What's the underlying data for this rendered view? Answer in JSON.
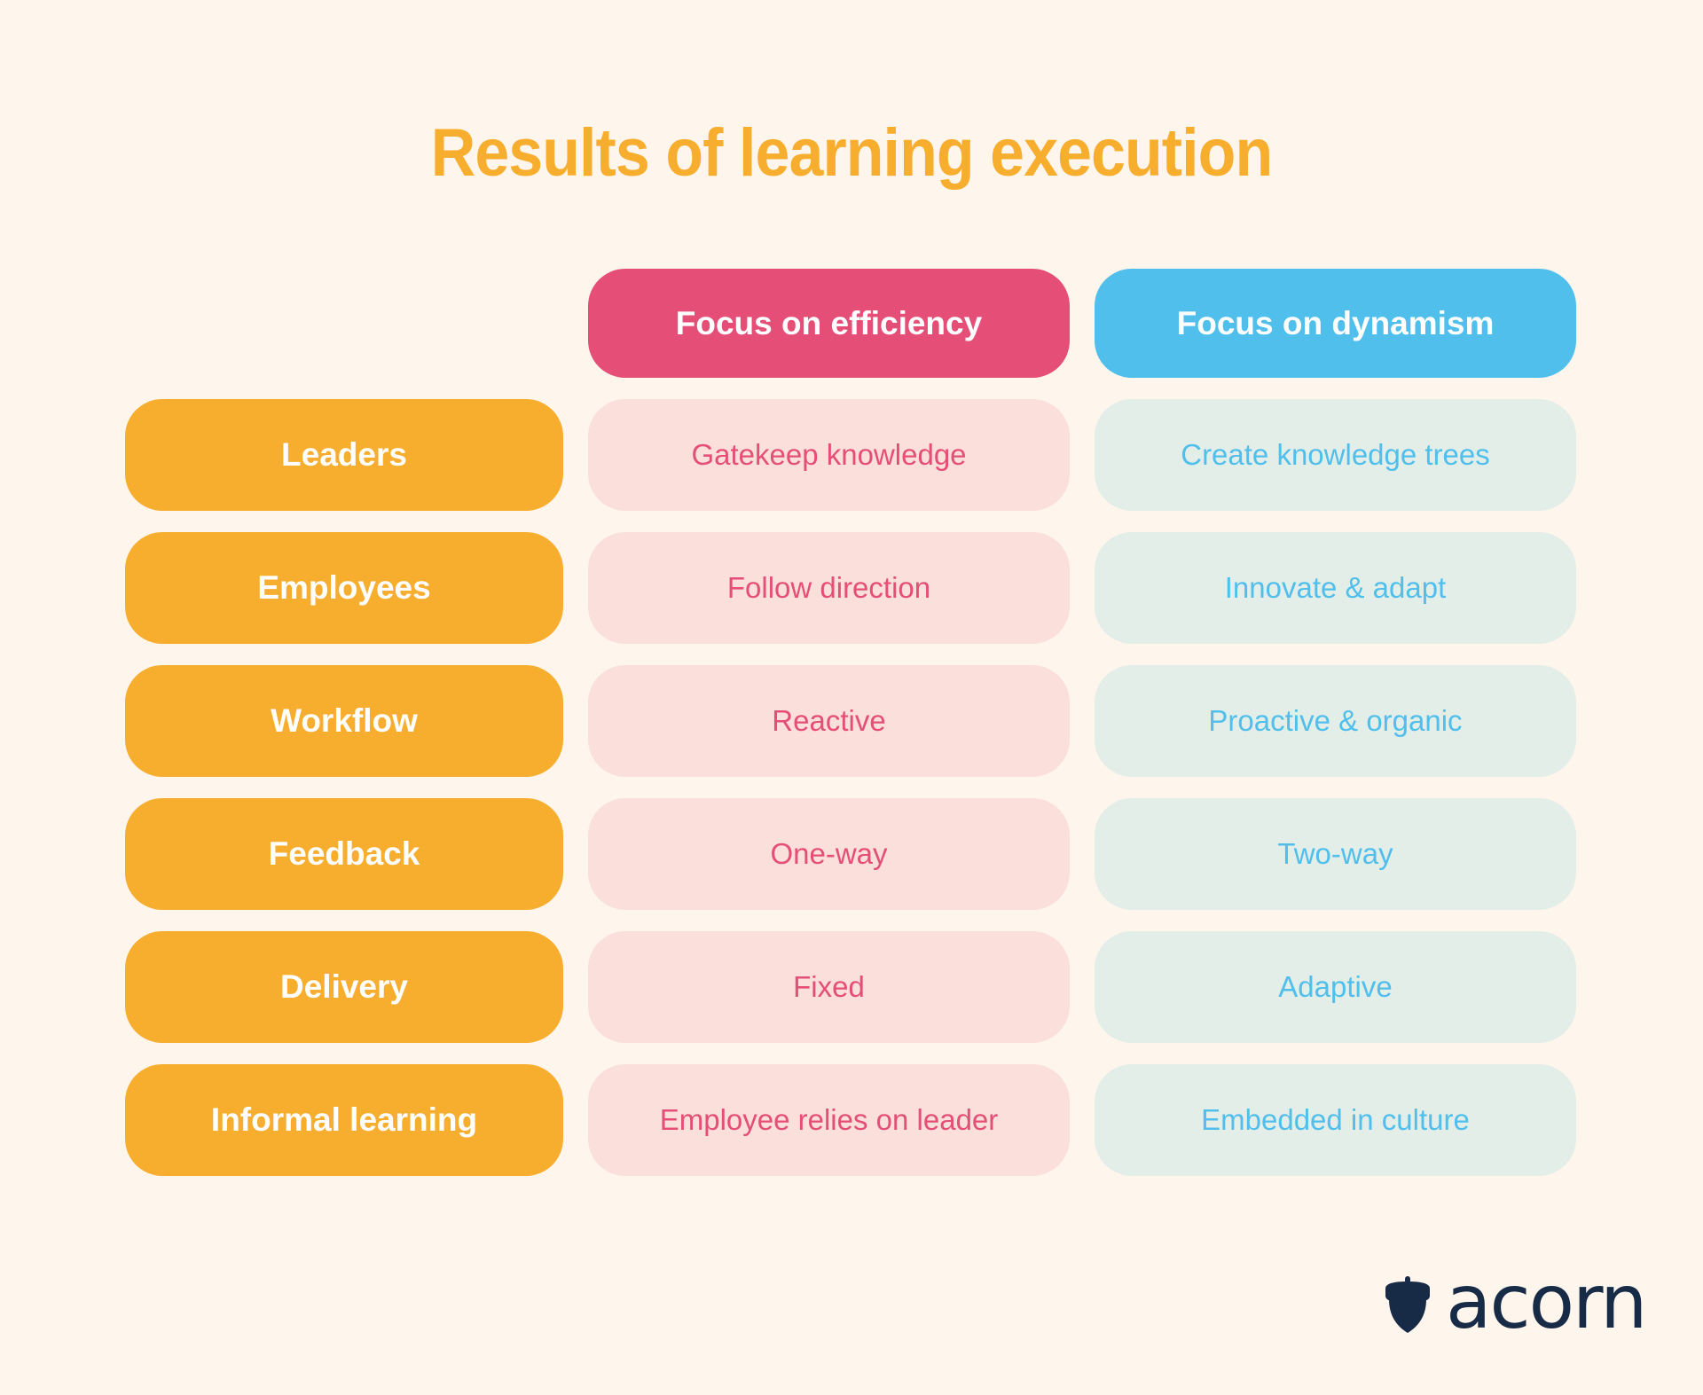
{
  "title": "Results of learning execution",
  "columns": [
    {
      "label": "Focus on efficiency",
      "color": "#e54f77",
      "cell_bg": "#fadfdb"
    },
    {
      "label": "Focus on dynamism",
      "color": "#50bfec",
      "cell_bg": "#e4eee9"
    }
  ],
  "row_label_color": "#f7ae2f",
  "rows": [
    {
      "label": "Leaders",
      "efficiency": "Gatekeep knowledge",
      "dynamism": "Create knowledge trees"
    },
    {
      "label": "Employees",
      "efficiency": "Follow direction",
      "dynamism": "Innovate & adapt"
    },
    {
      "label": "Workflow",
      "efficiency": "Reactive",
      "dynamism": "Proactive & organic"
    },
    {
      "label": "Feedback",
      "efficiency": "One-way",
      "dynamism": "Two-way"
    },
    {
      "label": "Delivery",
      "efficiency": "Fixed",
      "dynamism": "Adaptive"
    },
    {
      "label": "Informal learning",
      "efficiency": "Employee relies on leader",
      "dynamism": "Embedded in culture"
    }
  ],
  "logo": {
    "icon": "acorn-icon",
    "text": "acorn",
    "color": "#172b47"
  }
}
